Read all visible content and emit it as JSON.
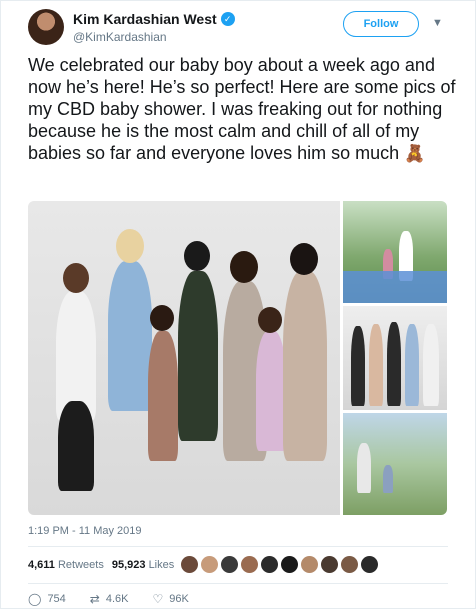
{
  "author": {
    "name": "Kim Kardashian West",
    "handle": "@KimKardashian",
    "verified": true
  },
  "follow_label": "Follow",
  "tweet_text": "We celebrated our baby boy about a week ago and now he’s here! He’s so perfect!  Here are some pics of my CBD baby shower. I was freaking out for nothing because he is the most calm and chill of all of my babies so far and everyone loves him so much",
  "emoji": "🧸",
  "timestamp": "1:19 PM - 11 May 2019",
  "stats": {
    "retweets_count": "4,611",
    "retweets_label": "Retweets",
    "likes_count": "95,923",
    "likes_label": "Likes"
  },
  "actions": {
    "replies": "754",
    "retweets": "4.6K",
    "likes": "96K"
  },
  "likers": [
    "#6b4a3a",
    "#c79b7a",
    "#3a3a3a",
    "#9a6b50",
    "#2b2b2b",
    "#1a1a1a",
    "#b48a6a",
    "#4a3a30",
    "#7a5a45",
    "#2a2a2a"
  ],
  "icons": {
    "verified": "verified-badge-icon",
    "chevron": "chevron-down-icon",
    "reply": "reply-icon",
    "retweet": "retweet-icon",
    "like": "heart-icon"
  }
}
